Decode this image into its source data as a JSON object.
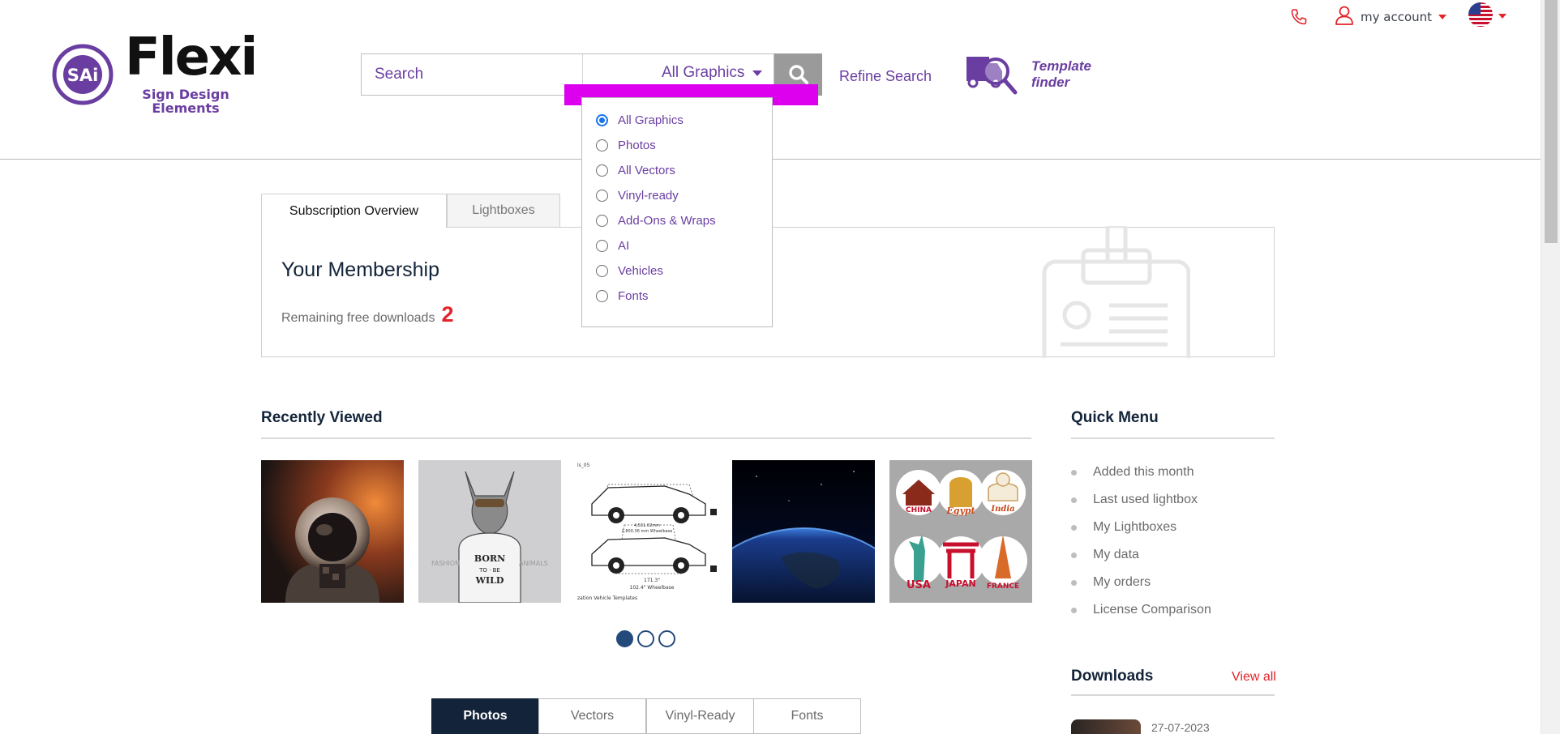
{
  "header": {
    "account_label": "my account",
    "logo": {
      "word": "Flexi",
      "subtitle_line1": "Sign Design",
      "subtitle_line2": "Elements",
      "badge": "SAi"
    },
    "search": {
      "placeholder": "Search",
      "category": "All Graphics"
    },
    "refine_label": "Refine Search",
    "template_finder": {
      "line1": "Template",
      "line2": "finder"
    }
  },
  "category_dropdown": {
    "selected": "All Graphics",
    "options": [
      "All Graphics",
      "Photos",
      "All Vectors",
      "Vinyl-ready",
      "Add-Ons & Wraps",
      "AI",
      "Vehicles",
      "Fonts"
    ]
  },
  "subscription": {
    "tabs": [
      "Subscription Overview",
      "Lightboxes"
    ],
    "title": "Your Membership",
    "remaining_label": "Remaining free downloads",
    "remaining_count": "2"
  },
  "recently_viewed": {
    "title": "Recently Viewed",
    "items": [
      "astronaut",
      "wolf",
      "vehicle-template",
      "earth",
      "travel-stickers"
    ],
    "wolf_shirt_text": "BORN TO BE WILD",
    "wolf_side_left": "FASHION",
    "wolf_side_right": "ANIMALS",
    "sticker_labels": [
      "CHINA",
      "Egypt",
      "India",
      "USA",
      "JAPAN",
      "FRANCE"
    ],
    "vehicle_labels": [
      "4,531.02mm",
      "2,800.36 mm Wheelbase",
      "171.3\"",
      "102.4\" Wheelbase",
      "zation Vehicle Templates",
      "ls_05"
    ],
    "carousel_pages": 3,
    "carousel_active": 1
  },
  "bottom_tabs": {
    "items": [
      "Photos",
      "Vectors",
      "Vinyl-Ready",
      "Fonts"
    ],
    "active": "Photos"
  },
  "quick_menu": {
    "title": "Quick Menu",
    "items": [
      "Added this month",
      "Last used lightbox",
      "My Lightboxes",
      "My data",
      "My orders",
      "License Comparison"
    ]
  },
  "downloads": {
    "title": "Downloads",
    "view_all": "View all",
    "first_date": "27-07-2023"
  },
  "colors": {
    "brand_purple": "#6a3ea1",
    "accent_red": "#e3242b",
    "navy": "#13243a",
    "highlight_magenta": "#dd00ef"
  }
}
